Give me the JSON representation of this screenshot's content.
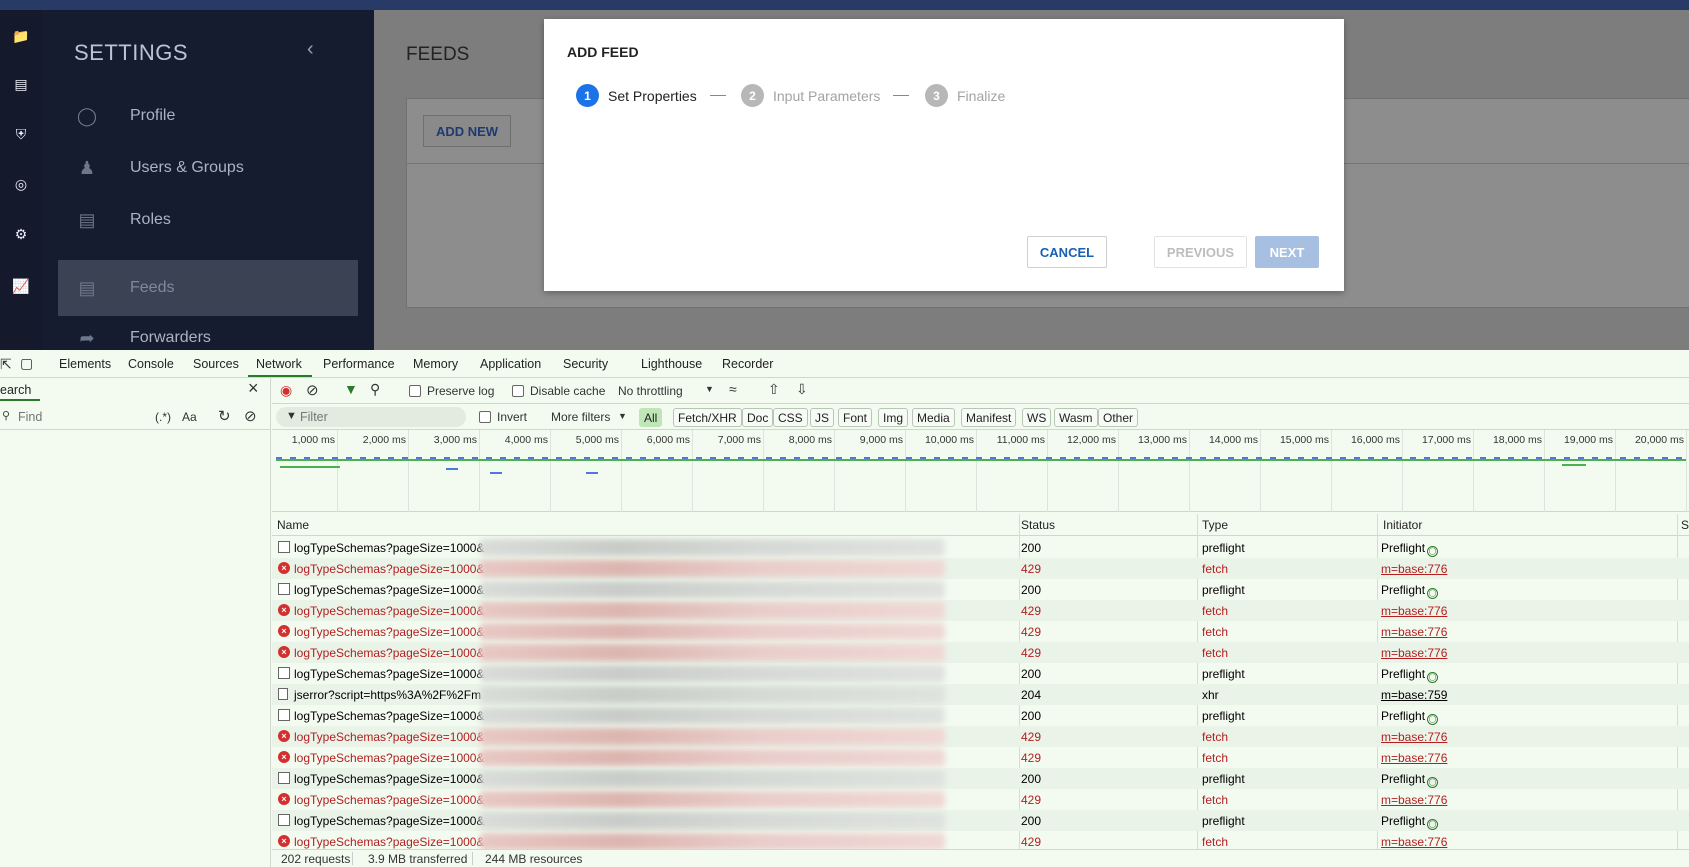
{
  "app": {
    "rail_icons": [
      "folder-icon",
      "contact-card-icon",
      "shield-icon",
      "radar-icon",
      "gear-icon",
      "chart-icon"
    ],
    "sidebar": {
      "title": "SETTINGS",
      "items": [
        {
          "label": "Profile",
          "icon": "person-icon"
        },
        {
          "label": "Users & Groups",
          "icon": "group-icon"
        },
        {
          "label": "Roles",
          "icon": "badge-icon"
        },
        {
          "label": "Feeds",
          "icon": "feeds-icon",
          "active": true
        },
        {
          "label": "Forwarders",
          "icon": "forward-icon"
        }
      ]
    },
    "main": {
      "title": "FEEDS",
      "add_new": "ADD NEW"
    },
    "modal": {
      "title": "ADD FEED",
      "steps": [
        {
          "num": "1",
          "label": "Set Properties",
          "active": true
        },
        {
          "num": "2",
          "label": "Input Parameters",
          "active": false
        },
        {
          "num": "3",
          "label": "Finalize",
          "active": false
        }
      ],
      "cancel": "CANCEL",
      "previous": "PREVIOUS",
      "next": "NEXT"
    },
    "colors": {
      "accent": "#1a73e8",
      "sidebar_bg": "#151c2f",
      "disabled_btn": "#a7bfe0"
    }
  },
  "devtools": {
    "tabs": [
      "Elements",
      "Console",
      "Sources",
      "Network",
      "Performance",
      "Memory",
      "Application",
      "Security",
      "Lighthouse",
      "Recorder"
    ],
    "active_tab": "Network",
    "search": {
      "label": "Search",
      "find_placeholder": "Find",
      "regex": "(.*)",
      "case": "Aa"
    },
    "toolbar": {
      "preserve_log": "Preserve log",
      "disable_cache": "Disable cache",
      "throttling": "No throttling"
    },
    "filterbar": {
      "filter_placeholder": "Filter",
      "invert": "Invert",
      "more_filters": "More filters",
      "types": [
        "All",
        "Fetch/XHR",
        "Doc",
        "CSS",
        "JS",
        "Font",
        "Img",
        "Media",
        "Manifest",
        "WS",
        "Wasm",
        "Other"
      ],
      "selected": "All"
    },
    "timeline_labels": [
      "1,000 ms",
      "2,000 ms",
      "3,000 ms",
      "4,000 ms",
      "5,000 ms",
      "6,000 ms",
      "7,000 ms",
      "8,000 ms",
      "9,000 ms",
      "10,000 ms",
      "11,000 ms",
      "12,000 ms",
      "13,000 ms",
      "14,000 ms",
      "15,000 ms",
      "16,000 ms",
      "17,000 ms",
      "18,000 ms",
      "19,000 ms",
      "20,000 ms"
    ],
    "columns": [
      "Name",
      "Status",
      "Type",
      "Initiator",
      "Si"
    ],
    "rows": [
      {
        "name": "logTypeSchemas?pageSize=1000&",
        "status": "200",
        "type": "preflight",
        "initiator": "Preflight",
        "kind": "box"
      },
      {
        "name": "logTypeSchemas?pageSize=1000&",
        "status": "429",
        "type": "fetch",
        "initiator": "m=base:776",
        "kind": "err"
      },
      {
        "name": "logTypeSchemas?pageSize=1000&",
        "status": "200",
        "type": "preflight",
        "initiator": "Preflight",
        "kind": "box"
      },
      {
        "name": "logTypeSchemas?pageSize=1000&",
        "status": "429",
        "type": "fetch",
        "initiator": "m=base:776",
        "kind": "err"
      },
      {
        "name": "logTypeSchemas?pageSize=1000&",
        "status": "429",
        "type": "fetch",
        "initiator": "m=base:776",
        "kind": "err"
      },
      {
        "name": "logTypeSchemas?pageSize=1000&",
        "status": "429",
        "type": "fetch",
        "initiator": "m=base:776",
        "kind": "err"
      },
      {
        "name": "logTypeSchemas?pageSize=1000&",
        "status": "200",
        "type": "preflight",
        "initiator": "Preflight",
        "kind": "box"
      },
      {
        "name": "jserror?script=https%3A%2F%2Fm",
        "status": "204",
        "type": "xhr",
        "initiator": "m=base:759",
        "kind": "doc"
      },
      {
        "name": "logTypeSchemas?pageSize=1000&",
        "status": "200",
        "type": "preflight",
        "initiator": "Preflight",
        "kind": "box"
      },
      {
        "name": "logTypeSchemas?pageSize=1000&",
        "status": "429",
        "type": "fetch",
        "initiator": "m=base:776",
        "kind": "err"
      },
      {
        "name": "logTypeSchemas?pageSize=1000&",
        "status": "429",
        "type": "fetch",
        "initiator": "m=base:776",
        "kind": "err"
      },
      {
        "name": "logTypeSchemas?pageSize=1000&",
        "status": "200",
        "type": "preflight",
        "initiator": "Preflight",
        "kind": "box"
      },
      {
        "name": "logTypeSchemas?pageSize=1000&",
        "status": "429",
        "type": "fetch",
        "initiator": "m=base:776",
        "kind": "err"
      },
      {
        "name": "logTypeSchemas?pageSize=1000&",
        "status": "200",
        "type": "preflight",
        "initiator": "Preflight",
        "kind": "box"
      },
      {
        "name": "logTypeSchemas?pageSize=1000&",
        "status": "429",
        "type": "fetch",
        "initiator": "m=base:776",
        "kind": "err"
      }
    ],
    "status": {
      "requests": "202 requests",
      "transferred": "3.9 MB transferred",
      "resources": "244 MB resources"
    }
  }
}
